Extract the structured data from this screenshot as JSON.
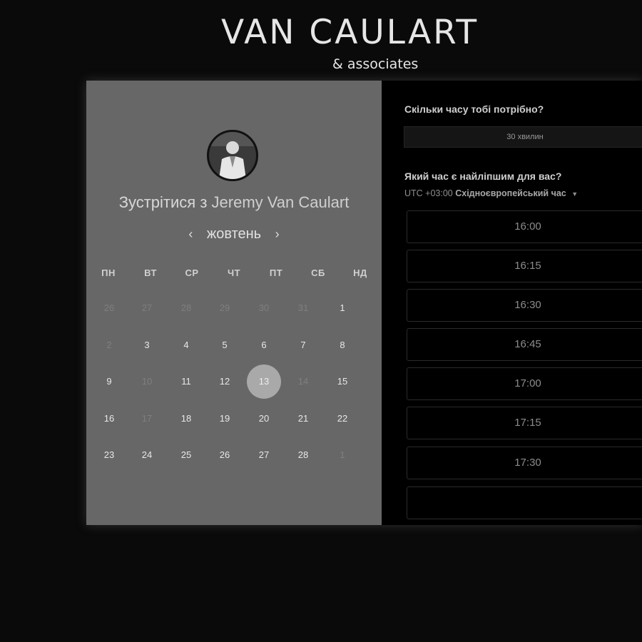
{
  "brand": {
    "title": "VAN CAULART",
    "subtitle": "& associates"
  },
  "host": {
    "prefix": "Зустрітися з",
    "name": "Jeremy Van Caulart"
  },
  "calendar": {
    "month": "жовтень",
    "prev_icon": "chevron-left-icon",
    "next_icon": "chevron-right-icon",
    "weekdays": [
      "ПН",
      "ВТ",
      "СР",
      "ЧТ",
      "ПТ",
      "СБ",
      "НД"
    ],
    "weeks": [
      [
        {
          "d": "26",
          "state": "muted"
        },
        {
          "d": "27",
          "state": "muted"
        },
        {
          "d": "28",
          "state": "muted"
        },
        {
          "d": "29",
          "state": "muted"
        },
        {
          "d": "30",
          "state": "muted"
        },
        {
          "d": "31",
          "state": "muted"
        },
        {
          "d": "1",
          "state": "available"
        }
      ],
      [
        {
          "d": "2",
          "state": "muted"
        },
        {
          "d": "3",
          "state": "available"
        },
        {
          "d": "4",
          "state": "available"
        },
        {
          "d": "5",
          "state": "available"
        },
        {
          "d": "6",
          "state": "available"
        },
        {
          "d": "7",
          "state": "available"
        },
        {
          "d": "8",
          "state": "available"
        }
      ],
      [
        {
          "d": "9",
          "state": "available"
        },
        {
          "d": "10",
          "state": "muted"
        },
        {
          "d": "11",
          "state": "available"
        },
        {
          "d": "12",
          "state": "available"
        },
        {
          "d": "13",
          "state": "selected"
        },
        {
          "d": "14",
          "state": "muted"
        },
        {
          "d": "15",
          "state": "available"
        }
      ],
      [
        {
          "d": "16",
          "state": "available"
        },
        {
          "d": "17",
          "state": "muted"
        },
        {
          "d": "18",
          "state": "available"
        },
        {
          "d": "19",
          "state": "available"
        },
        {
          "d": "20",
          "state": "available"
        },
        {
          "d": "21",
          "state": "available"
        },
        {
          "d": "22",
          "state": "available"
        }
      ],
      [
        {
          "d": "23",
          "state": "available"
        },
        {
          "d": "24",
          "state": "available"
        },
        {
          "d": "25",
          "state": "available"
        },
        {
          "d": "26",
          "state": "available"
        },
        {
          "d": "27",
          "state": "available"
        },
        {
          "d": "28",
          "state": "available"
        },
        {
          "d": "1",
          "state": "muted"
        }
      ]
    ]
  },
  "duration": {
    "question": "Скільки часу тобі потрібно?",
    "value": "30 хвилин"
  },
  "time": {
    "question": "Який час є найліпшим для вас?",
    "timezone_offset": "UTC +03:00",
    "timezone_name": "Східноєвропейський час",
    "slots": [
      "16:00",
      "16:15",
      "16:30",
      "16:45",
      "17:00",
      "17:15",
      "17:30"
    ]
  },
  "colors": {
    "page_bg": "#0a0a0a",
    "left_panel": "#676767",
    "right_panel": "#000000",
    "selected_day": "#a9a9a9"
  }
}
